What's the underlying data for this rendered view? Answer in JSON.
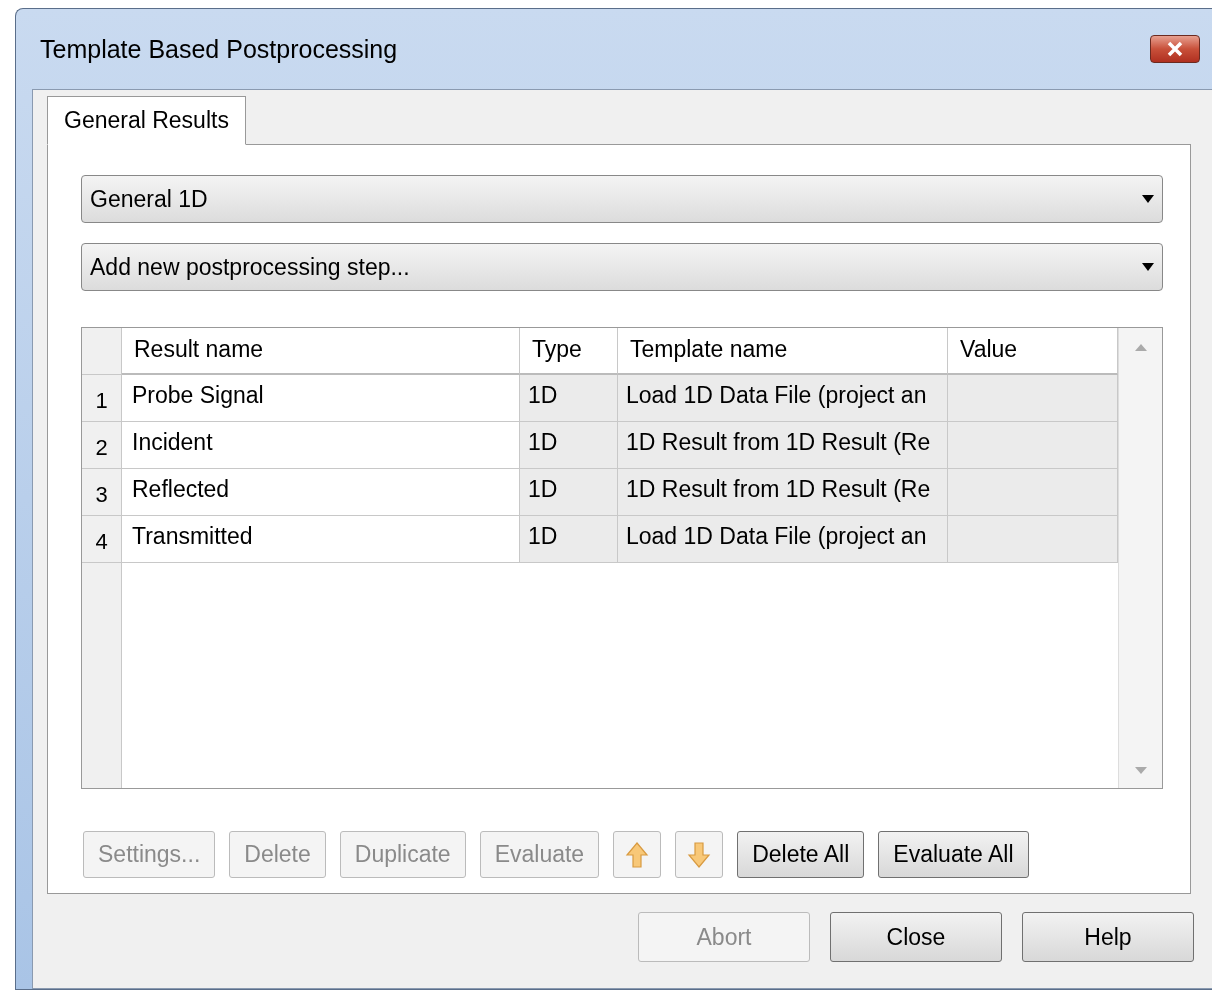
{
  "window": {
    "title": "Template Based Postprocessing"
  },
  "tabs": [
    {
      "label": "General Results",
      "selected": true
    }
  ],
  "dropdowns": [
    {
      "value": "General 1D"
    },
    {
      "value": "Add new postprocessing step..."
    }
  ],
  "table": {
    "columns": [
      "Result name",
      "Type",
      "Template name",
      "Value"
    ],
    "rows": [
      {
        "number": "1",
        "result_name": "Probe Signal",
        "type": "1D",
        "template_name": "Load 1D Data File (project an"
      },
      {
        "number": "2",
        "result_name": "Incident",
        "type": "1D",
        "template_name": "1D Result from 1D Result (Re"
      },
      {
        "number": "3",
        "result_name": "Reflected",
        "type": "1D",
        "template_name": "1D Result from 1D Result (Re"
      },
      {
        "number": "4",
        "result_name": "Transmitted",
        "type": "1D",
        "template_name": "Load 1D Data File (project an"
      }
    ]
  },
  "action_buttons": [
    {
      "kind": "text",
      "label": "Settings...",
      "disabled": true
    },
    {
      "kind": "text",
      "label": "Delete",
      "disabled": true
    },
    {
      "kind": "text",
      "label": "Duplicate",
      "disabled": true
    },
    {
      "kind": "text",
      "label": "Evaluate",
      "disabled": true
    },
    {
      "kind": "up",
      "disabled": true
    },
    {
      "kind": "down",
      "disabled": true
    },
    {
      "kind": "text",
      "label": "Delete All",
      "disabled": false
    },
    {
      "kind": "text",
      "label": "Evaluate All",
      "disabled": false
    }
  ],
  "dialog_buttons": [
    {
      "label": "Abort",
      "disabled": true
    },
    {
      "label": "Close",
      "disabled": false
    },
    {
      "label": "Help",
      "disabled": false
    }
  ]
}
